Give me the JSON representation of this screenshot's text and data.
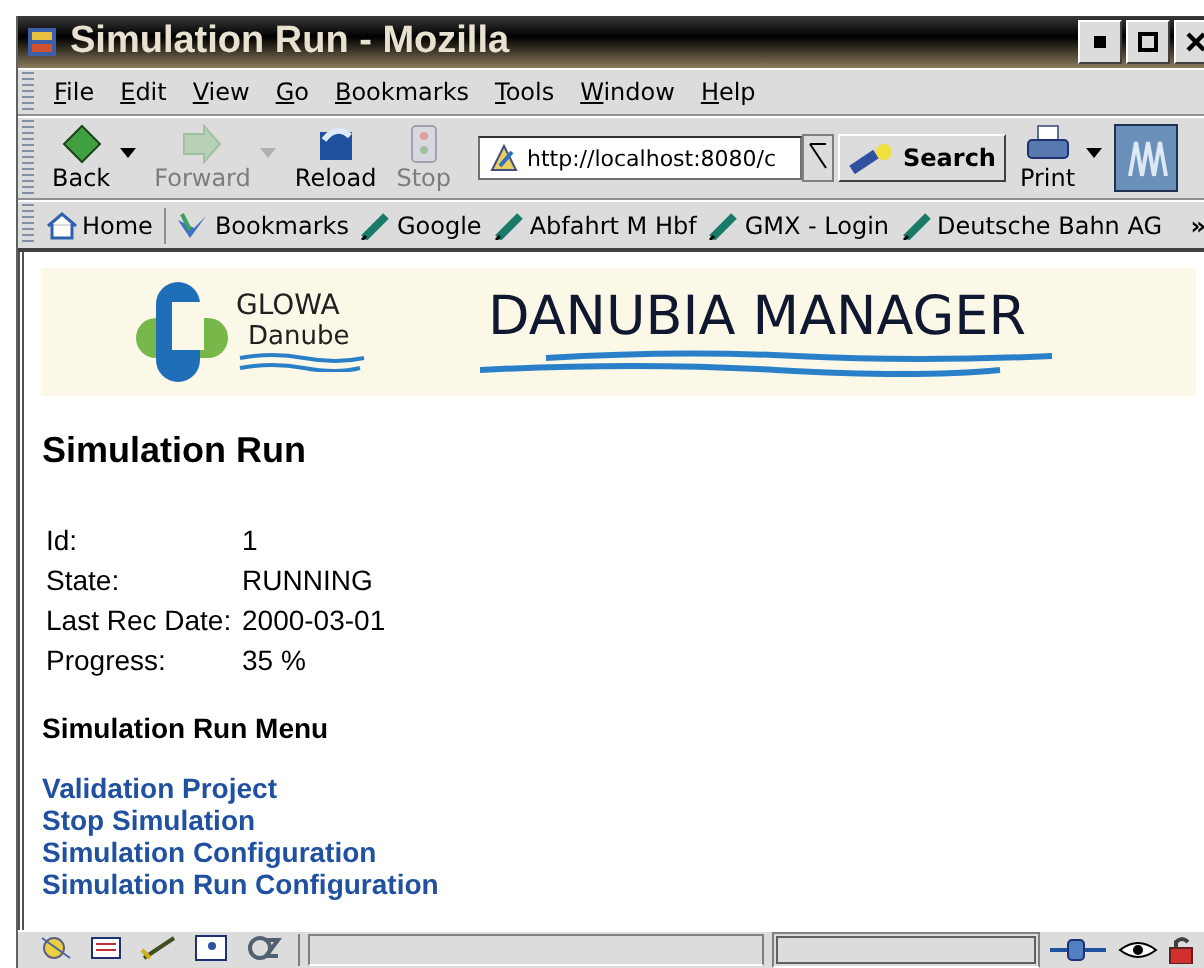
{
  "window": {
    "title": "Simulation Run - Mozilla"
  },
  "menu": [
    "File",
    "Edit",
    "View",
    "Go",
    "Bookmarks",
    "Tools",
    "Window",
    "Help"
  ],
  "toolbar": [
    {
      "kind": "back",
      "label": "Back",
      "disabled": false,
      "dropdown": true
    },
    {
      "kind": "forward",
      "label": "Forward",
      "disabled": true,
      "dropdown": true
    },
    {
      "kind": "reload",
      "label": "Reload",
      "disabled": false,
      "dropdown": false
    },
    {
      "kind": "stop",
      "label": "Stop",
      "disabled": true,
      "dropdown": false
    }
  ],
  "address": {
    "value": "http://localhost:8080/c"
  },
  "search_button": "Search",
  "print_button": "Print",
  "bookmarks": [
    {
      "kind": "home",
      "label": "Home"
    },
    {
      "kind": "folder",
      "label": "Bookmarks"
    },
    {
      "kind": "link",
      "label": "Google"
    },
    {
      "kind": "link",
      "label": "Abfahrt M Hbf"
    },
    {
      "kind": "link",
      "label": "GMX - Login"
    },
    {
      "kind": "link",
      "label": "Deutsche Bahn AG"
    }
  ],
  "bookmarks_more": "»",
  "banner": {
    "logo_top": "GLOWA",
    "logo_bottom": "Danube",
    "title": "DANUBIA MANAGER"
  },
  "heading": "Simulation Run",
  "details": [
    {
      "label": "Id:",
      "value": "1"
    },
    {
      "label": "State:",
      "value": "RUNNING"
    },
    {
      "label": "Last Rec Date:",
      "value": "2000-03-01"
    },
    {
      "label": "Progress:",
      "value": "35 %"
    }
  ],
  "menu_heading": "Simulation Run Menu",
  "links": [
    "Validation Project",
    "Stop Simulation",
    "Simulation Configuration",
    "Simulation Run Configuration"
  ]
}
